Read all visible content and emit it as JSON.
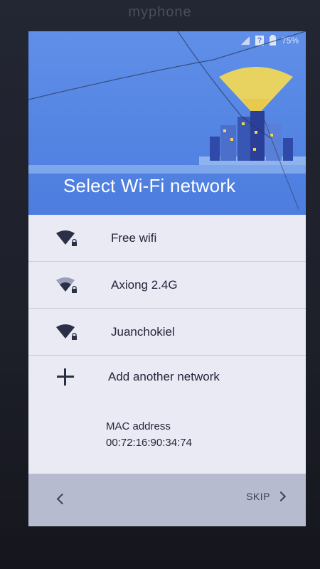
{
  "device": {
    "brand": "myphone"
  },
  "status_bar": {
    "battery": "75%",
    "sim_icon": "sim-warning-icon",
    "signal_icon": "signal-icon",
    "battery_icon": "battery-icon"
  },
  "header": {
    "title": "Select Wi-Fi network",
    "accent_color": "#4c7ddf"
  },
  "networks": [
    {
      "name": "Free wifi",
      "icon": "wifi-locked-icon"
    },
    {
      "name": "Axiong 2.4G",
      "icon": "wifi-locked-icon"
    },
    {
      "name": "Juanchokiel",
      "icon": "wifi-locked-icon"
    }
  ],
  "add_network": {
    "label": "Add another network",
    "icon": "plus-icon"
  },
  "mac": {
    "label": "MAC address",
    "value": "00:72:16:90:34:74"
  },
  "navigation": {
    "back_icon": "chevron-left-icon",
    "skip_label": "SKIP",
    "skip_icon": "chevron-right-icon"
  }
}
